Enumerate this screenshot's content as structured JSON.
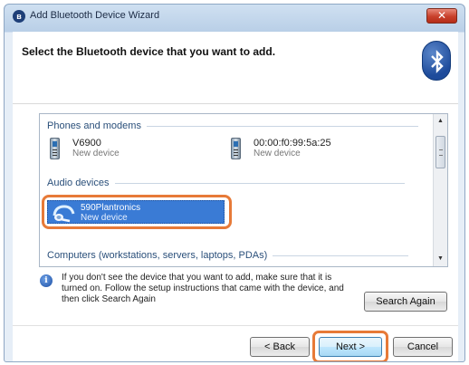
{
  "window": {
    "title": "Add Bluetooth Device Wizard",
    "close_glyph": "✕"
  },
  "header": {
    "title": "Select the Bluetooth device that you want to add."
  },
  "groups": {
    "phones": {
      "label": "Phones and modems",
      "devices": [
        {
          "name": "V6900",
          "status": "New device"
        },
        {
          "name": "00:00:f0:99:5a:25",
          "status": "New device"
        }
      ]
    },
    "audio": {
      "label": "Audio devices",
      "devices": [
        {
          "name": "590Plantronics",
          "status": "New device"
        }
      ]
    },
    "computers": {
      "label": "Computers (workstations, servers, laptops, PDAs)"
    }
  },
  "info": {
    "text": "If you don't see the device that you want to add, make sure that it is turned on. Follow the setup instructions that came with the device, and then click Search Again"
  },
  "buttons": {
    "search_again": "Search Again",
    "back": "< Back",
    "next": "Next >",
    "cancel": "Cancel"
  },
  "colors": {
    "selection": "#3a7bd5",
    "highlight_ring": "#e77a38"
  }
}
